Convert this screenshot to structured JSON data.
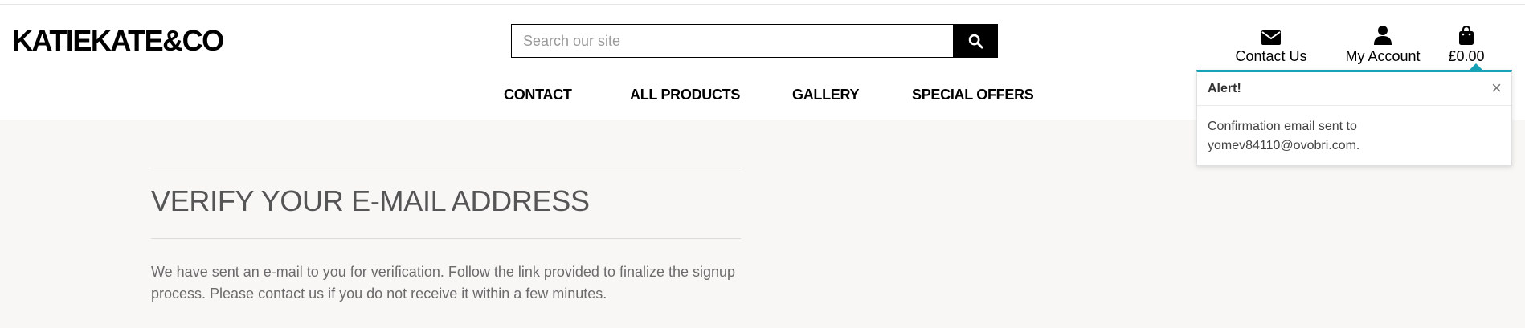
{
  "header": {
    "logo": "KATIEKATE&CO",
    "search": {
      "placeholder": "Search our site",
      "value": ""
    },
    "utilities": {
      "contact_label": "Contact Us",
      "account_label": "My Account",
      "bag_total": "£0.00"
    }
  },
  "nav": {
    "items": [
      {
        "label": "CONTACT"
      },
      {
        "label": "ALL PRODUCTS"
      },
      {
        "label": "GALLERY"
      },
      {
        "label": "SPECIAL OFFERS"
      }
    ]
  },
  "main": {
    "title": "VERIFY YOUR E-MAIL ADDRESS",
    "body": "We have sent an e-mail to you for verification. Follow the link provided to finalize the signup process. Please contact us if you do not receive it within a few minutes."
  },
  "alert": {
    "title": "Alert!",
    "close_symbol": "×",
    "message": "Confirmation email sent to yomev84110@ovobri.com."
  },
  "colors": {
    "accent": "#17a2b8",
    "page_background": "#f8f7f5",
    "text_muted": "#6b6b6b"
  }
}
